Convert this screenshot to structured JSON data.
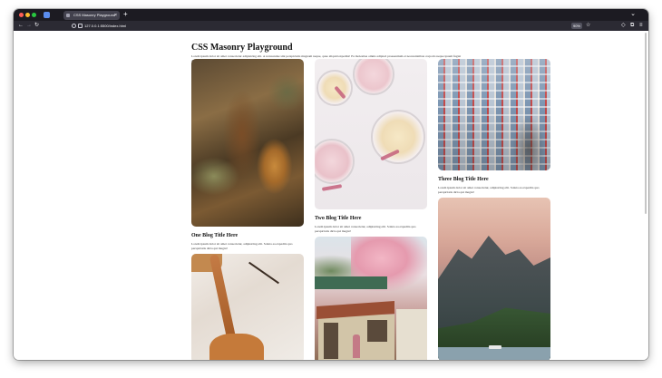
{
  "browser": {
    "tab_title": "CSS Masonry Playground",
    "tab_close": "×",
    "new_tab": "+",
    "url": "127.0.0.1:5500/index.html",
    "zoom": "90%"
  },
  "page": {
    "title": "CSS Masonry Playground",
    "intro": "Lorem ipsum dolor sit amet consectetur adipisicing elit. A recusandae sint perspiciatis magnam neque, quae aliquid expedita! Ea molestiae omnis adipisci praesentium et necessitatibus corporis neque ipsum fugiat dolorum maiores!"
  },
  "cards": [
    {
      "image": "tree-bark-photo",
      "title": "One Blog Title Here",
      "text": "Lorem ipsum dolor sit amet consectetur, adipisicing elit. Soluta ea expedita quo perspiciatis dicta qui magni!"
    },
    {
      "image": "cocktail-glasses-photo",
      "title": "Two Blog Title Here",
      "text": "Lorem ipsum dolor sit amet consectetur, adipisicing elit. Soluta ea expedita quo perspiciatis dicta qui magni!"
    },
    {
      "image": "apartment-building-photo",
      "title": "Three Blog Title Here",
      "text": "Lorem ipsum dolor sit amet consectetur, adipisicing elit. Soluta ea expedita quo perspiciatis dicta qui magni!"
    },
    {
      "image": "mountain-lake-photo"
    },
    {
      "image": "coffee-pour-photo"
    },
    {
      "image": "cherry-blossom-house-photo"
    }
  ]
}
